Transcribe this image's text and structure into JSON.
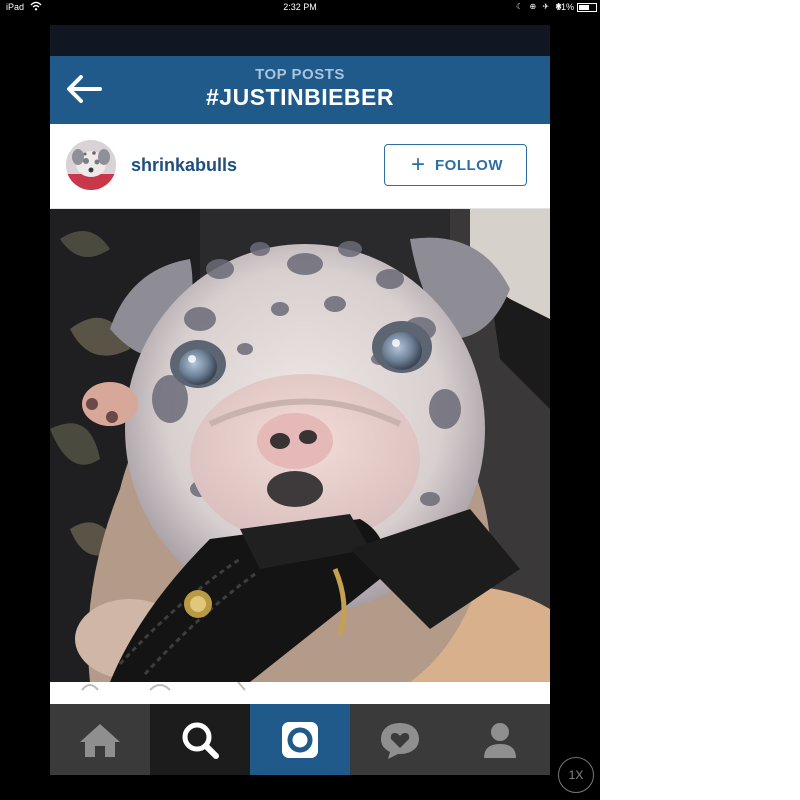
{
  "status_bar": {
    "device": "iPad",
    "time": "2:32 PM",
    "battery": "61%"
  },
  "header": {
    "subtitle": "TOP POSTS",
    "title": "#JUSTINBIEBER"
  },
  "post": {
    "username": "shrinkabulls",
    "follow_label": "FOLLOW",
    "follow_plus": "+",
    "photo_subject": "merle bulldog puppy chewing a black leather bag strap"
  },
  "tab_bar": {
    "tabs": [
      {
        "name": "home",
        "icon": "home-icon",
        "active": false
      },
      {
        "name": "search",
        "icon": "search-icon",
        "active": true
      },
      {
        "name": "camera",
        "icon": "camera-icon",
        "active": false
      },
      {
        "name": "activity",
        "icon": "heart-speech-bubble-icon",
        "active": false
      },
      {
        "name": "profile",
        "icon": "person-icon",
        "active": false
      }
    ]
  },
  "zoom_button": {
    "label": "1X"
  },
  "colors": {
    "header_bg": "#1f5a8b",
    "header_subtitle": "#a9c4dd",
    "username": "#1f4f7e",
    "follow_accent": "#2d6ea5",
    "tab_bar_bg": "#3a3a3a",
    "tab_active_search_bg": "#1c1c1c",
    "tab_active_camera_bg": "#1f5a8b"
  }
}
